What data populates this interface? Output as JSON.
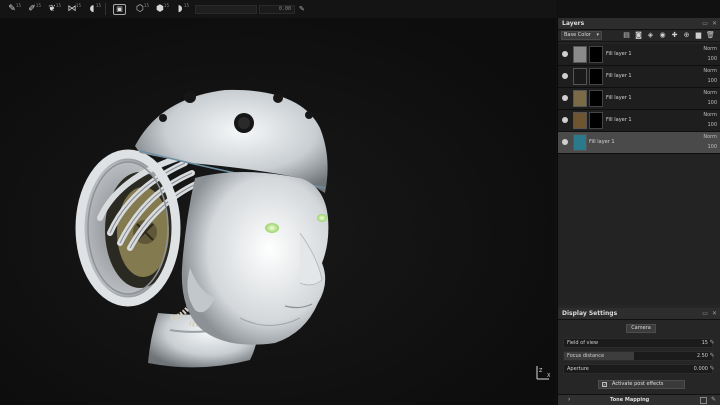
{
  "toolbar": {
    "icons": [
      "paint-brush-icon",
      "eraser-icon",
      "smudge-icon",
      "clone-icon",
      "projection-icon",
      "camera-icon",
      "polyfill-icon",
      "symmetry-icon"
    ],
    "sup": [
      "15",
      "15",
      "15",
      "15",
      "15",
      "15",
      "15",
      "15"
    ],
    "value": "0.00"
  },
  "layers": {
    "title": "Layers",
    "channel": "Base Color",
    "rows": [
      {
        "name": "Fill layer 1",
        "blend": "Norm",
        "opacity": "100",
        "thumb": "#8a8a8a",
        "selected": false
      },
      {
        "name": "Fill layer 1",
        "blend": "Norm",
        "opacity": "100",
        "thumb": "#1a1a1a",
        "selected": false
      },
      {
        "name": "Fill layer 1",
        "blend": "Norm",
        "opacity": "100",
        "thumb": "#7a6a45",
        "selected": false
      },
      {
        "name": "Fill layer 1",
        "blend": "Norm",
        "opacity": "100",
        "thumb": "#6e5530",
        "selected": false
      },
      {
        "name": "Fill layer 1",
        "blend": "Norm",
        "opacity": "100",
        "thumb": "#2b7a8c",
        "selected": true
      }
    ]
  },
  "display_settings": {
    "title": "Display Settings",
    "camera_tab": "Camera",
    "fields": [
      {
        "label": "Field of view",
        "value": "15",
        "fill": 0.0
      },
      {
        "label": "Focus distance",
        "value": "2.50",
        "fill": 0.47
      },
      {
        "label": "Aperture",
        "value": "0.000",
        "fill": 0.0
      }
    ],
    "post_effects_label": "Activate post effects",
    "post_effects_checked": true,
    "tone_mapping_label": "Tone Mapping"
  },
  "viewport": {
    "axis_labels": [
      "Z",
      "X"
    ]
  }
}
